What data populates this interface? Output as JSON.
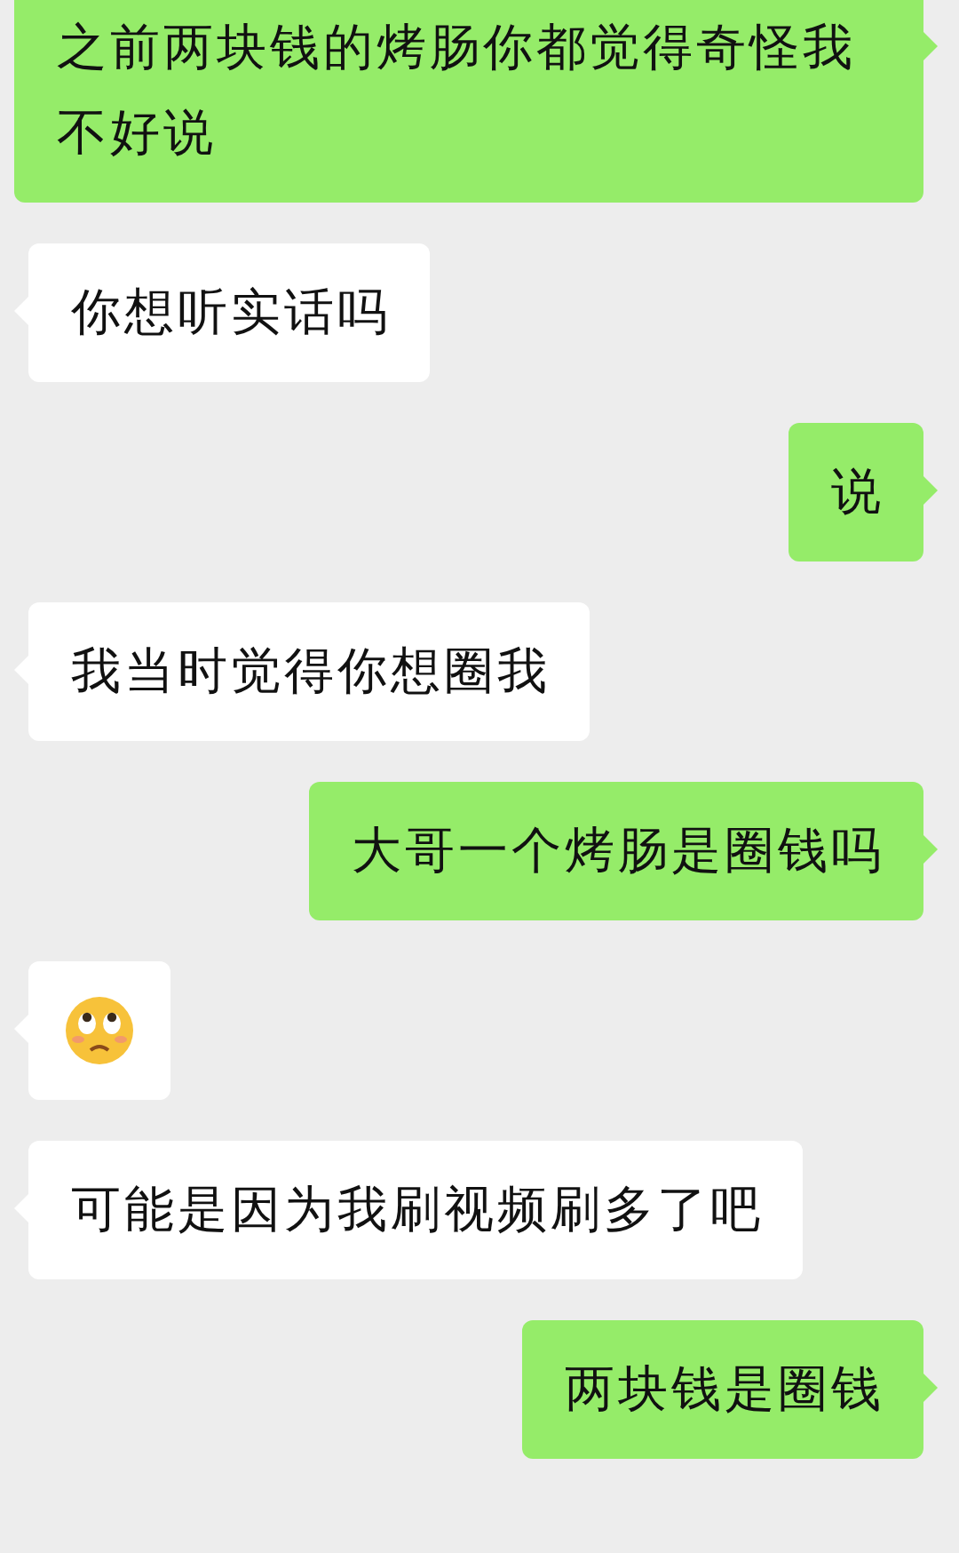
{
  "messages": [
    {
      "outgoing": true,
      "kind": "text",
      "text": "之前两块钱的烤肠你都觉得奇怪我不好说"
    },
    {
      "outgoing": false,
      "kind": "text",
      "text": "你想听实话吗"
    },
    {
      "outgoing": true,
      "kind": "text",
      "text": "说"
    },
    {
      "outgoing": false,
      "kind": "text",
      "text": "我当时觉得你想圈我"
    },
    {
      "outgoing": true,
      "kind": "text",
      "text": "大哥一个烤肠是圈钱吗"
    },
    {
      "outgoing": false,
      "kind": "emoji"
    },
    {
      "outgoing": false,
      "kind": "text",
      "text": "可能是因为我刷视频刷多了吧"
    },
    {
      "outgoing": true,
      "kind": "text",
      "text": "两块钱是圈钱"
    }
  ]
}
